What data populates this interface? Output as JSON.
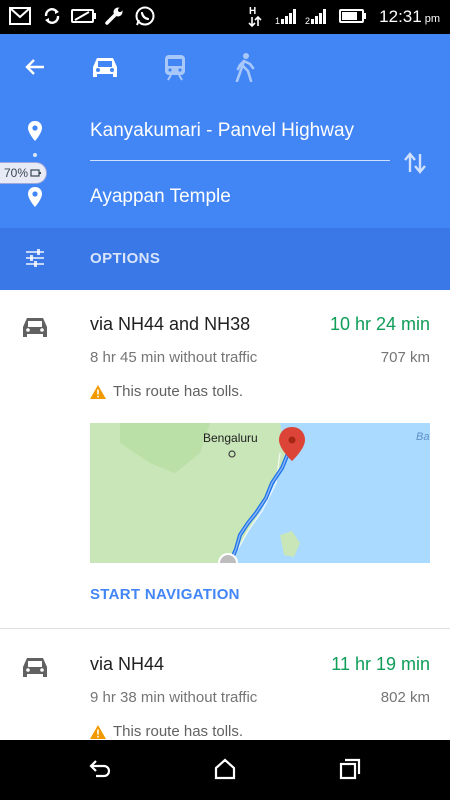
{
  "status_bar": {
    "time": "12:31",
    "ampm": "pm",
    "icons": [
      "gmail-icon",
      "sync-icon",
      "battery-saver-icon",
      "wrench-icon",
      "whatsapp-icon",
      "data-arrows-icon",
      "signal-icon",
      "signal-2-icon",
      "battery-icon"
    ]
  },
  "header": {
    "from": "Kanyakumari - Panvel Highway",
    "to": "Ayappan Temple",
    "modes": [
      "car-icon",
      "transit-icon",
      "walk-icon"
    ],
    "battery_badge": "70%"
  },
  "options": {
    "label": "OPTIONS"
  },
  "routes": [
    {
      "via": "via NH44 and NH38",
      "duration": "10 hr 24 min",
      "without_traffic": "8 hr 45 min without traffic",
      "distance": "707 km",
      "toll": "This route has tolls.",
      "map": {
        "city_label": "Bengaluru",
        "sea_label": "Ba"
      },
      "start_navigation": "START NAVIGATION"
    },
    {
      "via": "via NH44",
      "duration": "11 hr 19 min",
      "without_traffic": "9 hr 38 min without traffic",
      "distance": "802 km",
      "toll": "This route has tolls."
    }
  ],
  "colors": {
    "header": "#4285f4",
    "options": "#3b78e7",
    "duration": "#0f9d58",
    "toll_warning": "#f29900"
  }
}
